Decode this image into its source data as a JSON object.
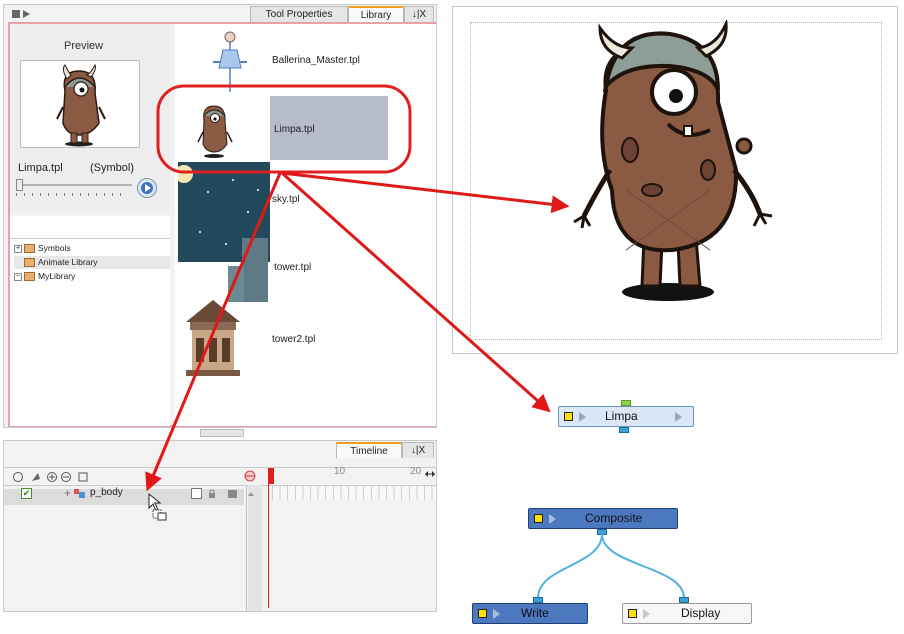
{
  "library_window": {
    "tabs": [
      {
        "label": "Tool Properties"
      },
      {
        "label": "Library"
      },
      {
        "label": "↓|X"
      }
    ],
    "preview": {
      "title": "Preview",
      "symbol_name": "Limpa.tpl",
      "symbol_type": "(Symbol)"
    },
    "tree": [
      {
        "label": "Symbols",
        "expander": "+"
      },
      {
        "label": "Animate Library",
        "expander": ""
      },
      {
        "label": "MyLibrary",
        "expander": "−"
      }
    ],
    "templates": [
      {
        "label": "Ballerina_Master.tpl"
      },
      {
        "label": "Limpa.tpl"
      },
      {
        "label": "sky.tpl"
      },
      {
        "label": "tower.tpl"
      },
      {
        "label": "tower2.tpl"
      }
    ],
    "selected_template": "Limpa.tpl"
  },
  "timeline": {
    "tab_label": "Timeline",
    "close_label": "↓|X",
    "frame_numbers": [
      "10",
      "20"
    ],
    "layer": {
      "name": "p_body",
      "enabled": true
    }
  },
  "nodes": {
    "limpa": "Limpa",
    "composite": "Composite",
    "write": "Write",
    "display": "Display"
  },
  "colors": {
    "highlight_ring": "#e02020",
    "arrow": "#e01818",
    "selection": "#b7bccb",
    "node_blue": "#4c78c0",
    "node_light": "#dbe7f7",
    "cable": "#4fb0e0"
  }
}
